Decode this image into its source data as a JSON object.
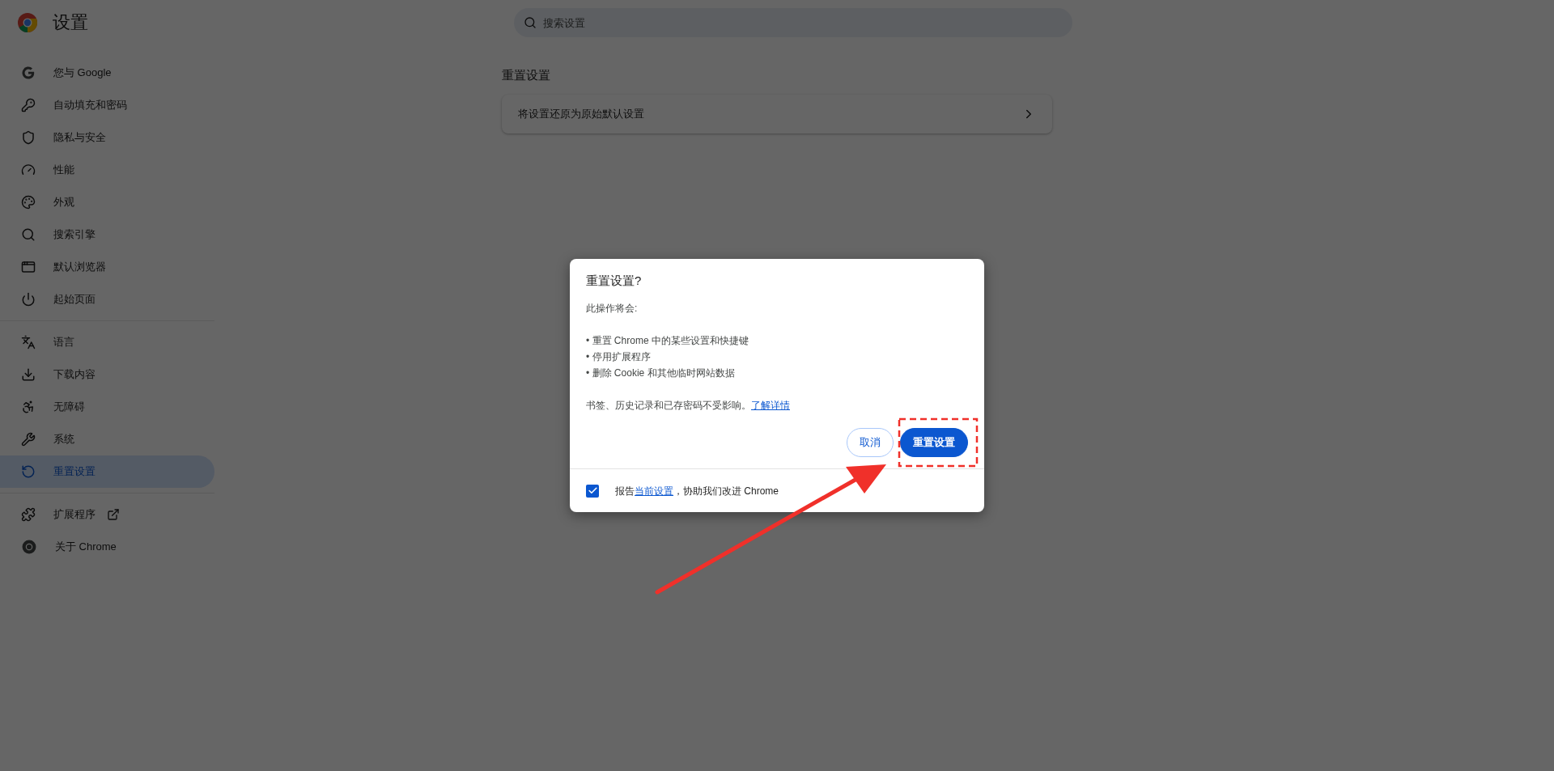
{
  "header": {
    "title": "设置",
    "search": {
      "placeholder": "搜索设置"
    }
  },
  "sidebar": {
    "sections": [
      {
        "items": [
          {
            "label": "您与 Google",
            "selected": false
          },
          {
            "label": "自动填充和密码",
            "selected": false
          },
          {
            "label": "隐私与安全",
            "selected": false
          },
          {
            "label": "性能",
            "selected": false
          },
          {
            "label": "外观",
            "selected": false
          },
          {
            "label": "搜索引擎",
            "selected": false
          },
          {
            "label": "默认浏览器",
            "selected": false
          },
          {
            "label": "起始页面",
            "selected": false
          }
        ]
      },
      {
        "items": [
          {
            "label": "语言",
            "selected": false
          },
          {
            "label": "下载内容",
            "selected": false
          },
          {
            "label": "无障碍",
            "selected": false
          },
          {
            "label": "系统",
            "selected": false
          },
          {
            "label": "重置设置",
            "selected": true
          }
        ]
      },
      {
        "items": [
          {
            "label": "扩展程序",
            "selected": false,
            "external": true
          },
          {
            "label": "关于 Chrome",
            "selected": false
          }
        ]
      }
    ]
  },
  "main": {
    "section_title": "重置设置",
    "row": {
      "label": "将设置还原为原始默认设置"
    }
  },
  "dialog": {
    "title": "重置设置?",
    "intro": "此操作将会:",
    "bullets": [
      "• 重置 Chrome 中的某些设置和快捷键",
      "• 停用扩展程序",
      "• 删除 Cookie 和其他临时网站数据"
    ],
    "note": "书签、历史记录和已存密码不受影响。",
    "note_link": "了解详情",
    "buttons": [
      {
        "label": "取消",
        "kind": "secondary"
      },
      {
        "label": "重置设置",
        "kind": "primary"
      }
    ],
    "footer": {
      "checked": true,
      "before": "报告",
      "link": "当前设置",
      "after": "，协助我们改进 Chrome"
    }
  },
  "annotation": {
    "highlight_box": true,
    "arrow": true
  }
}
